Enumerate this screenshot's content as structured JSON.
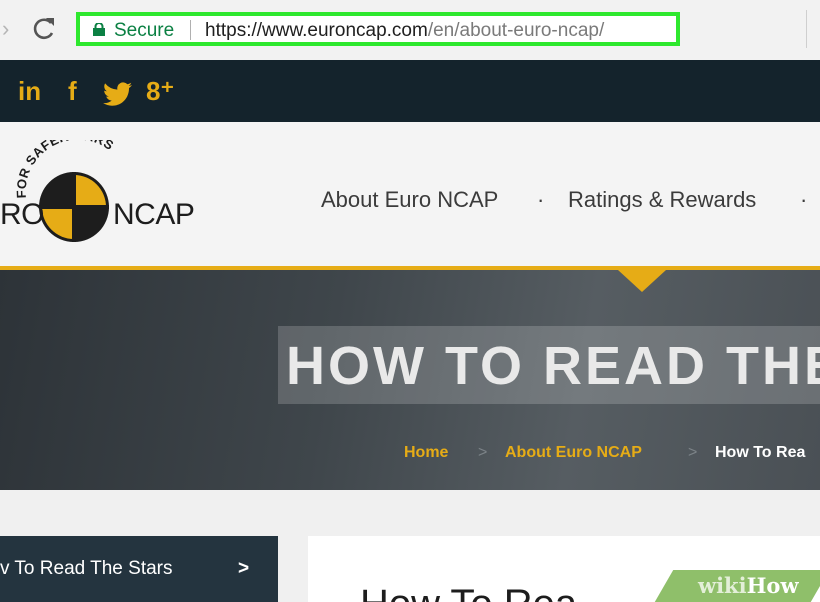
{
  "browser": {
    "forward_glyph": "›",
    "security_label": "Secure",
    "url_host": "https://www.euroncap.com",
    "url_path": "/en/about-euro-ncap/"
  },
  "social": {
    "icons": [
      "linkedin-icon",
      "facebook-icon",
      "twitter-icon",
      "google-plus-icon"
    ],
    "glyphs": [
      "in",
      "f",
      "",
      "8⁺"
    ]
  },
  "logo": {
    "tagline": "FOR SAFER CARS",
    "text_left": "RO",
    "text_right": "NCAP"
  },
  "nav": {
    "items": [
      "About Euro NCAP",
      "Ratings & Rewards"
    ],
    "separator": "·"
  },
  "hero": {
    "title": "HOW TO READ THE",
    "breadcrumbs": [
      "Home",
      "About Euro NCAP",
      "How To Rea"
    ],
    "separator": ">"
  },
  "sidebar": {
    "active_item": "v To Read The Stars",
    "chevron": ">"
  },
  "main": {
    "title": "How To Rea"
  },
  "watermark": {
    "part1": "wiki",
    "part2": "How"
  },
  "colors": {
    "accent": "#e6ac16",
    "dark": "#14232c",
    "url_highlight": "#2ee82e",
    "secure_green": "#0b8043"
  }
}
